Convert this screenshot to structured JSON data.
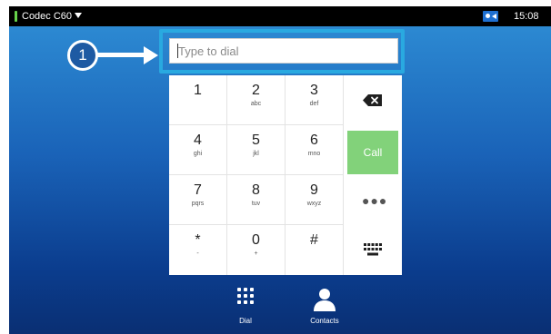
{
  "status_bar": {
    "device_name": "Codec C60",
    "time": "15:08",
    "indicator_color": "#66d14a"
  },
  "callout": {
    "number": "1",
    "highlight_color": "#29a9e0"
  },
  "dial_field": {
    "placeholder": "Type to dial",
    "value": ""
  },
  "keypad": {
    "keys": [
      {
        "digit": "1",
        "letters": ""
      },
      {
        "digit": "2",
        "letters": "abc"
      },
      {
        "digit": "3",
        "letters": "def"
      },
      {
        "digit": "4",
        "letters": "ghi"
      },
      {
        "digit": "5",
        "letters": "jkl"
      },
      {
        "digit": "6",
        "letters": "mno"
      },
      {
        "digit": "7",
        "letters": "pqrs"
      },
      {
        "digit": "8",
        "letters": "tuv"
      },
      {
        "digit": "9",
        "letters": "wxyz"
      },
      {
        "digit": "*",
        "letters": "-"
      },
      {
        "digit": "0",
        "letters": "+"
      },
      {
        "digit": "#",
        "letters": ""
      }
    ],
    "call_label": "Call",
    "call_color": "#82d27a"
  },
  "tabs": [
    {
      "label": "Dial",
      "icon": "dial-grid-icon"
    },
    {
      "label": "Contacts",
      "icon": "person-icon"
    }
  ]
}
